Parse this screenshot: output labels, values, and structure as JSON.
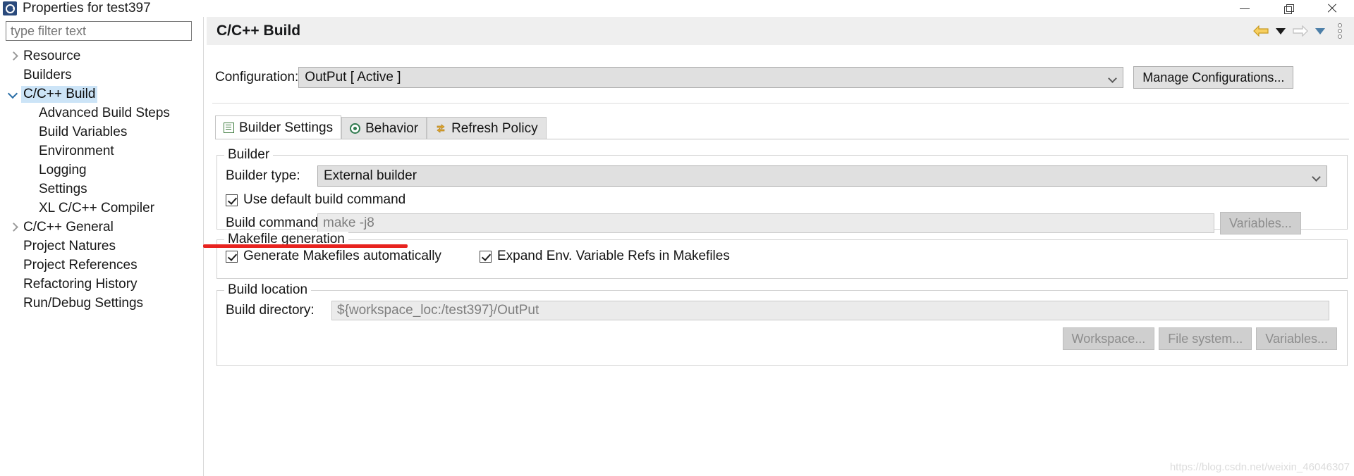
{
  "window": {
    "title": "Properties for test397",
    "icon": "eclipse-icon",
    "controls": {
      "minimize": "minimize-icon",
      "restore": "restore-icon",
      "close": "close-icon"
    }
  },
  "sidebar": {
    "filter": {
      "value": "",
      "placeholder": "type filter text"
    },
    "items": [
      {
        "label": "Resource",
        "indent": 0,
        "twisty": "collapsed",
        "selected": false
      },
      {
        "label": "Builders",
        "indent": 0,
        "twisty": "none",
        "selected": false
      },
      {
        "label": "C/C++ Build",
        "indent": 0,
        "twisty": "expanded",
        "selected": true
      },
      {
        "label": "Advanced Build Steps",
        "indent": 2,
        "twisty": "none",
        "selected": false
      },
      {
        "label": "Build Variables",
        "indent": 2,
        "twisty": "none",
        "selected": false
      },
      {
        "label": "Environment",
        "indent": 2,
        "twisty": "none",
        "selected": false
      },
      {
        "label": "Logging",
        "indent": 2,
        "twisty": "none",
        "selected": false
      },
      {
        "label": "Settings",
        "indent": 2,
        "twisty": "none",
        "selected": false
      },
      {
        "label": "XL C/C++ Compiler",
        "indent": 2,
        "twisty": "none",
        "selected": false
      },
      {
        "label": "C/C++ General",
        "indent": 0,
        "twisty": "collapsed",
        "selected": false
      },
      {
        "label": "Project Natures",
        "indent": 0,
        "twisty": "none",
        "selected": false
      },
      {
        "label": "Project References",
        "indent": 0,
        "twisty": "none",
        "selected": false
      },
      {
        "label": "Refactoring History",
        "indent": 0,
        "twisty": "none",
        "selected": false
      },
      {
        "label": "Run/Debug Settings",
        "indent": 0,
        "twisty": "none",
        "selected": false
      }
    ]
  },
  "page": {
    "title": "C/C++ Build",
    "nav": {
      "back": "back-arrow-icon",
      "back_menu": "chevron-down-icon",
      "forward": "forward-arrow-icon",
      "forward_menu": "chevron-down-icon",
      "menu": "view-menu-icon"
    },
    "configuration": {
      "label": "Configuration:",
      "value": "OutPut  [ Active ]",
      "manage_button": "Manage Configurations..."
    },
    "tabs": [
      {
        "label": "Builder Settings",
        "icon": "builder-settings-icon",
        "active": true
      },
      {
        "label": "Behavior",
        "icon": "behavior-icon",
        "active": false
      },
      {
        "label": "Refresh Policy",
        "icon": "refresh-policy-icon",
        "active": false
      }
    ],
    "builder_group": {
      "title": "Builder",
      "builder_type_label": "Builder type:",
      "builder_type_value": "External builder",
      "use_default_label": "Use default build command",
      "use_default_checked": true,
      "build_command_label": "Build command:",
      "build_command_value": "make -j8",
      "variables_button": "Variables..."
    },
    "makefile_group": {
      "title": "Makefile generation",
      "generate_label": "Generate Makefiles automatically",
      "generate_checked": true,
      "expand_label": "Expand Env. Variable Refs in Makefiles",
      "expand_checked": true
    },
    "location_group": {
      "title": "Build location",
      "directory_label": "Build directory:",
      "directory_value": "${workspace_loc:/test397}/OutPut",
      "workspace_button": "Workspace...",
      "filesystem_button": "File system...",
      "variables_button": "Variables..."
    }
  },
  "annotation": {
    "type": "red-underline",
    "color": "#e8231f"
  },
  "watermark": "https://blog.csdn.net/weixin_46046307"
}
